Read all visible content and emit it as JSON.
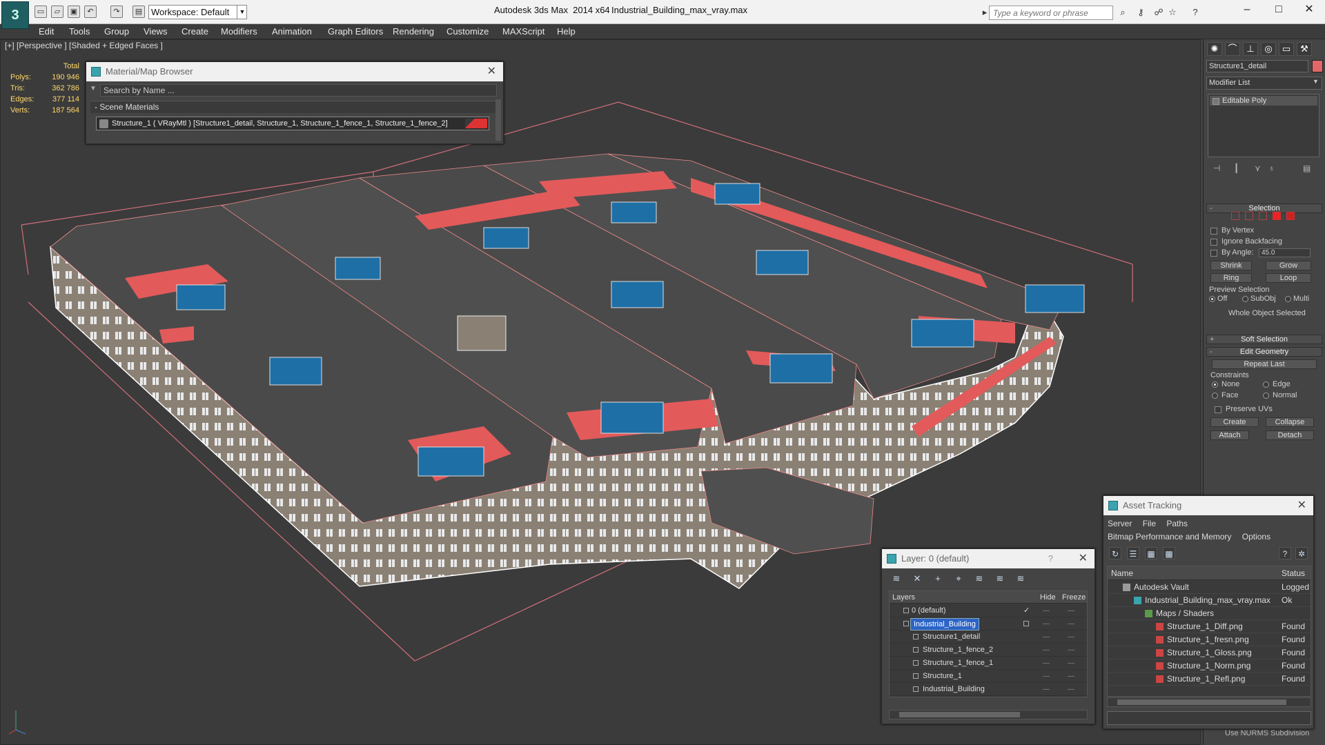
{
  "titlebar": {
    "workspace": "Workspace: Default",
    "app_title": "Autodesk 3ds Max  2014 x64",
    "file_title": "Industrial_Building_max_vray.max",
    "search_placeholder": "Type a keyword or phrase"
  },
  "menu": [
    "Edit",
    "Tools",
    "Group",
    "Views",
    "Create",
    "Modifiers",
    "Animation",
    "Graph Editors",
    "Rendering",
    "Customize",
    "MAXScript",
    "Help"
  ],
  "viewport": {
    "label": "[+] [Perspective ] [Shaded + Edged Faces ]",
    "stats": {
      "total_label": "Total",
      "rows": [
        {
          "label": "Polys:",
          "value": "190 946"
        },
        {
          "label": "Tris:",
          "value": "362 786"
        },
        {
          "label": "Edges:",
          "value": "377 114"
        },
        {
          "label": "Verts:",
          "value": "187 564"
        }
      ]
    }
  },
  "material_browser": {
    "title": "Material/Map Browser",
    "search_placeholder": "Search by Name ...",
    "section": "Scene Materials",
    "material": "Structure_1  ( VRayMtl )  [Structure1_detail, Structure_1, Structure_1_fence_1, Structure_1_fence_2]",
    "section_sign": "-"
  },
  "command_panel": {
    "object_name": "Structure1_detail",
    "object_color": "#e36767",
    "modifier_list": "Modifier List",
    "stack_item": "Editable Poly",
    "selection": {
      "title": "Selection",
      "by_vertex": "By Vertex",
      "ignore_backfacing": "Ignore Backfacing",
      "by_angle": "By Angle:",
      "angle_value": "45.0",
      "shrink": "Shrink",
      "grow": "Grow",
      "ring": "Ring",
      "loop": "Loop",
      "preview_selection": "Preview Selection",
      "off": "Off",
      "subobj": "SubObj",
      "multi": "Multi",
      "whole_object": "Whole Object Selected"
    },
    "soft_selection": "Soft Selection",
    "edit_geometry": {
      "title": "Edit Geometry",
      "repeat_last": "Repeat Last",
      "constraints": "Constraints",
      "none": "None",
      "edge": "Edge",
      "face": "Face",
      "normal": "Normal",
      "preserve_uvs": "Preserve UVs",
      "create": "Create",
      "collapse": "Collapse",
      "attach": "Attach",
      "detach": "Detach"
    },
    "use_nurms": "Use NURMS Subdivision"
  },
  "layer_panel": {
    "title": "Layer: 0 (default)",
    "help": "?",
    "columns": {
      "layers": "Layers",
      "hide": "Hide",
      "freeze": "Freeze"
    },
    "rows": [
      {
        "name": "0 (default)",
        "indent": 0
      },
      {
        "name": "Industrial_Building",
        "indent": 0,
        "selected": true
      },
      {
        "name": "Structure1_detail",
        "indent": 1
      },
      {
        "name": "Structure_1_fence_2",
        "indent": 1
      },
      {
        "name": "Structure_1_fence_1",
        "indent": 1
      },
      {
        "name": "Structure_1",
        "indent": 1
      },
      {
        "name": "Industrial_Building",
        "indent": 1
      }
    ],
    "dash": "—",
    "tick": "✓"
  },
  "asset_tracking": {
    "title": "Asset Tracking",
    "menu1": [
      "Server",
      "File",
      "Paths"
    ],
    "menu2": [
      "Bitmap Performance and Memory",
      "Options"
    ],
    "columns": {
      "name": "Name",
      "status": "Status"
    },
    "rows": [
      {
        "name": "Autodesk Vault",
        "status": "Logged C",
        "indent": 0,
        "type": "vault"
      },
      {
        "name": "Industrial_Building_max_vray.max",
        "status": "Ok",
        "indent": 1,
        "type": "max"
      },
      {
        "name": "Maps / Shaders",
        "status": "",
        "indent": 2,
        "type": "folder"
      },
      {
        "name": "Structure_1_Diff.png",
        "status": "Found",
        "indent": 3,
        "type": "png"
      },
      {
        "name": "Structure_1_fresn.png",
        "status": "Found",
        "indent": 3,
        "type": "png"
      },
      {
        "name": "Structure_1_Gloss.png",
        "status": "Found",
        "indent": 3,
        "type": "png"
      },
      {
        "name": "Structure_1_Norm.png",
        "status": "Found",
        "indent": 3,
        "type": "png"
      },
      {
        "name": "Structure_1_Refl.png",
        "status": "Found",
        "indent": 3,
        "type": "png"
      }
    ]
  },
  "colors": {
    "accent_red": "#e35a5a",
    "selection_blue": "#2b64c6",
    "stats_yellow": "#ffd86b"
  }
}
